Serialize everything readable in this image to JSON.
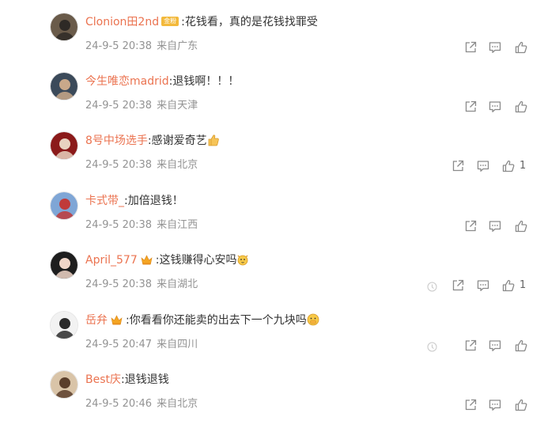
{
  "comments": [
    {
      "username": "Clonion田2nd",
      "badge": "金粉",
      "colon": ":",
      "text": "花钱看，真的是花钱找罪受",
      "time": "24-9-5 20:38",
      "location": "来自广东",
      "likes": "",
      "has_crown": false,
      "emoji": "",
      "has_extra_icon": false,
      "avatar_colors": [
        "#6a5b4a",
        "#2e2a26"
      ]
    },
    {
      "username": "今生唯恋madrid",
      "badge": "",
      "colon": ":",
      "text": "退钱啊！！！",
      "time": "24-9-5 20:38",
      "location": "来自天津",
      "likes": "",
      "has_crown": false,
      "emoji": "",
      "has_extra_icon": false,
      "avatar_colors": [
        "#3b4a5a",
        "#c9a88a"
      ]
    },
    {
      "username": "8号中场选手",
      "badge": "",
      "colon": ":",
      "text": "感谢爱奇艺",
      "time": "24-9-5 20:38",
      "location": "来自北京",
      "likes": "1",
      "has_crown": false,
      "emoji": "thumbs-up",
      "has_extra_icon": false,
      "avatar_colors": [
        "#8b1a1a",
        "#e8d2c0"
      ]
    },
    {
      "username": "卡式带_",
      "badge": "",
      "colon": ":",
      "text": "加倍退钱！",
      "time": "24-9-5 20:38",
      "location": "来自江西",
      "likes": "",
      "has_crown": false,
      "emoji": "",
      "has_extra_icon": false,
      "avatar_colors": [
        "#7fa6d6",
        "#c03a3a"
      ]
    },
    {
      "username": "April_577",
      "badge": "",
      "colon": ":",
      "text": "这钱赚得心安吗",
      "time": "24-9-5 20:38",
      "location": "来自湖北",
      "likes": "1",
      "has_crown": true,
      "emoji": "cat-face",
      "has_extra_icon": true,
      "avatar_colors": [
        "#1e1e1e",
        "#f0d6c8"
      ]
    },
    {
      "username": "岳弁",
      "badge": "",
      "colon": ":",
      "text": "你看看你还能卖的出去下一个九块吗",
      "time": "24-9-5 20:47",
      "location": "来自四川",
      "likes": "",
      "has_crown": true,
      "emoji": "hand-over-mouth",
      "has_extra_icon": true,
      "avatar_colors": [
        "#f2f2f2",
        "#2b2b2b"
      ]
    },
    {
      "username": "Best庆",
      "badge": "",
      "colon": ":",
      "text": "退钱退钱",
      "time": "24-9-5 20:46",
      "location": "来自北京",
      "likes": "",
      "has_crown": false,
      "emoji": "",
      "has_extra_icon": false,
      "avatar_colors": [
        "#d9c4a8",
        "#5a3e2b"
      ]
    }
  ],
  "colors": {
    "username": "#eb7350",
    "meta": "#939393",
    "text": "#333333",
    "icon": "#8a8a8a",
    "badge": "#f3b93b",
    "crown": "#f5a623"
  },
  "icons": {
    "share": "share-icon",
    "comment": "comment-icon",
    "like": "thumbs-up-icon",
    "extra": "circle-icon"
  }
}
